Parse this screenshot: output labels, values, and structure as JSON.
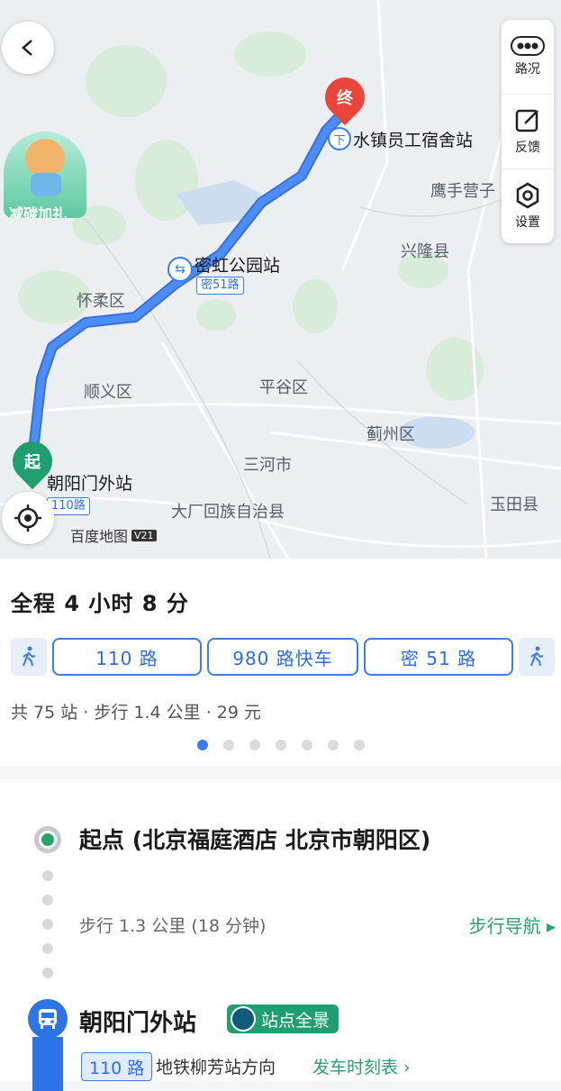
{
  "map": {
    "labels": {
      "huairou": "怀柔区",
      "shunyi": "顺义区",
      "pinggu": "平谷区",
      "sanhe": "三河市",
      "jizhou": "蓟州区",
      "dachang": "大厂回族自治县",
      "yutian": "玉田县",
      "xinglong": "兴隆县",
      "yingshou": "鹰手营子"
    },
    "stops": {
      "start": "朝阳门外站",
      "transfer": "密虹公园站",
      "end": "水镇员工宿舍站"
    },
    "route_badges": {
      "start": "110路",
      "transfer": "密51路"
    },
    "pins": {
      "start": "起",
      "end": "终"
    },
    "watermark": "百度地图",
    "watermark_version": "V21",
    "promo": "减碳加礼",
    "tools": {
      "traffic": "路况",
      "feedback": "反馈",
      "settings": "设置"
    }
  },
  "summary": {
    "title": "全程 4 小时 8 分",
    "legs": [
      "110 路",
      "980 路快车",
      "密 51 路"
    ],
    "meta": "共 75 站 · 步行 1.4 公里 · 29 元",
    "page_count": 7,
    "active_page": 1
  },
  "detail": {
    "start_label": "起点 (北京福庭酒店 北京市朝阳区)",
    "walk_info": "步行 1.3 公里 (18 分钟)",
    "walk_nav": "步行导航 ▸",
    "stop_name": "朝阳门外站",
    "panorama": "站点全景",
    "line": "110 路",
    "direction": "地铁柳芳站方向",
    "schedule": "发车时刻表 ›"
  },
  "colors": {
    "accent": "#3b7df0",
    "green": "#27a36b",
    "end_red": "#e9453a"
  }
}
